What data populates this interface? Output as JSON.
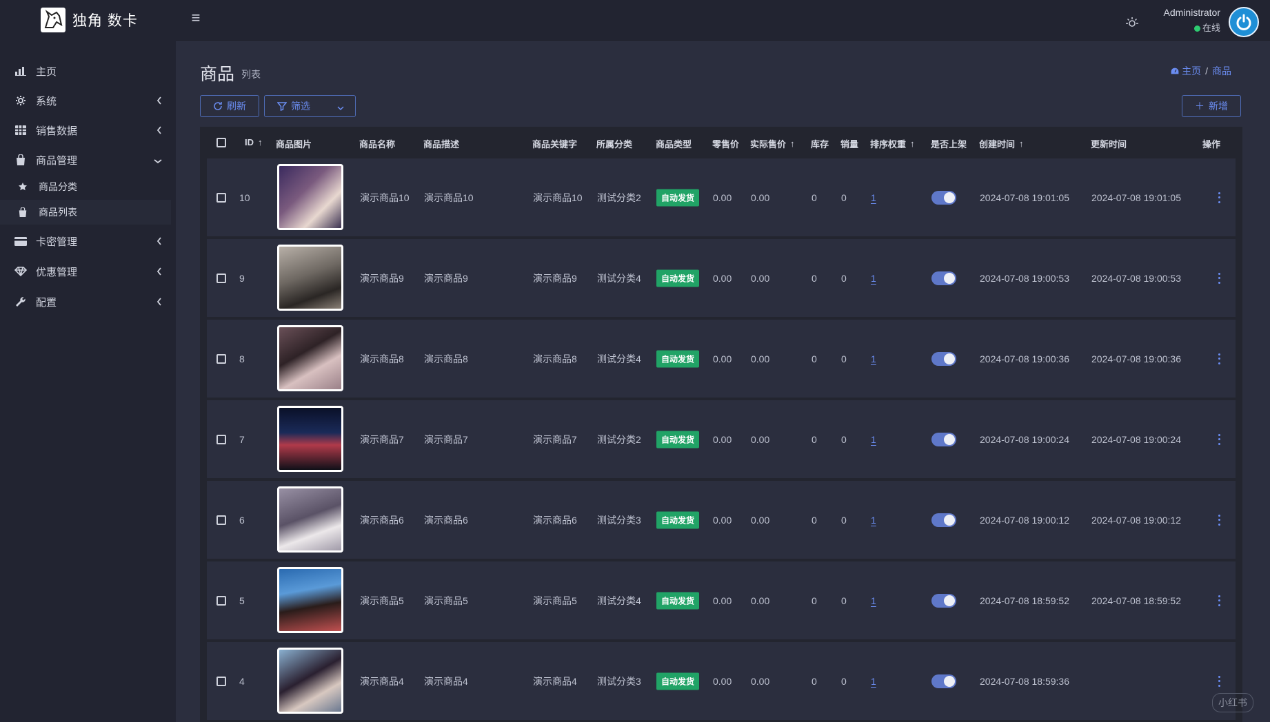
{
  "app": {
    "brand": "独角 数卡"
  },
  "user": {
    "name": "Administrator",
    "status": "在线"
  },
  "sidebar": {
    "items": [
      {
        "label": "主页",
        "icon": "bar-chart-icon"
      },
      {
        "label": "系统",
        "icon": "gear-icon"
      },
      {
        "label": "销售数据",
        "icon": "table-icon"
      },
      {
        "label": "商品管理",
        "icon": "shopping-bag-icon"
      },
      {
        "label": "卡密管理",
        "icon": "credit-card-icon"
      },
      {
        "label": "优惠管理",
        "icon": "diamond-icon"
      },
      {
        "label": "配置",
        "icon": "wrench-icon"
      }
    ],
    "sub_items": [
      {
        "label": "商品分类",
        "icon": "star-icon"
      },
      {
        "label": "商品列表",
        "icon": "shopping-bag-icon"
      }
    ]
  },
  "page": {
    "title": "商品",
    "subtitle": "列表"
  },
  "breadcrumb": {
    "home": "主页",
    "sep": "/",
    "current": "商品"
  },
  "toolbar": {
    "refresh": "刷新",
    "filter": "筛选",
    "add": "新增"
  },
  "table": {
    "headers": {
      "id": "ID",
      "image": "商品图片",
      "name": "商品名称",
      "desc": "商品描述",
      "keyword": "商品关键字",
      "category": "所属分类",
      "type": "商品类型",
      "retail": "零售价",
      "actual": "实际售价",
      "stock": "库存",
      "sales": "销量",
      "weight": "排序权重",
      "listed": "是否上架",
      "created": "创建时间",
      "updated": "更新时间",
      "ops": "操作"
    },
    "rows": [
      {
        "id": "10",
        "name": "演示商品10",
        "desc": "演示商品10",
        "keyword": "演示商品10",
        "category": "测试分类2",
        "type": "自动发货",
        "retail": "0.00",
        "actual": "0.00",
        "stock": "0",
        "sales": "0",
        "weight": "1",
        "created": "2024-07-08 19:01:05",
        "updated": "2024-07-08 19:01:05"
      },
      {
        "id": "9",
        "name": "演示商品9",
        "desc": "演示商品9",
        "keyword": "演示商品9",
        "category": "测试分类4",
        "type": "自动发货",
        "retail": "0.00",
        "actual": "0.00",
        "stock": "0",
        "sales": "0",
        "weight": "1",
        "created": "2024-07-08 19:00:53",
        "updated": "2024-07-08 19:00:53"
      },
      {
        "id": "8",
        "name": "演示商品8",
        "desc": "演示商品8",
        "keyword": "演示商品8",
        "category": "测试分类4",
        "type": "自动发货",
        "retail": "0.00",
        "actual": "0.00",
        "stock": "0",
        "sales": "0",
        "weight": "1",
        "created": "2024-07-08 19:00:36",
        "updated": "2024-07-08 19:00:36"
      },
      {
        "id": "7",
        "name": "演示商品7",
        "desc": "演示商品7",
        "keyword": "演示商品7",
        "category": "测试分类2",
        "type": "自动发货",
        "retail": "0.00",
        "actual": "0.00",
        "stock": "0",
        "sales": "0",
        "weight": "1",
        "created": "2024-07-08 19:00:24",
        "updated": "2024-07-08 19:00:24"
      },
      {
        "id": "6",
        "name": "演示商品6",
        "desc": "演示商品6",
        "keyword": "演示商品6",
        "category": "测试分类3",
        "type": "自动发货",
        "retail": "0.00",
        "actual": "0.00",
        "stock": "0",
        "sales": "0",
        "weight": "1",
        "created": "2024-07-08 19:00:12",
        "updated": "2024-07-08 19:00:12"
      },
      {
        "id": "5",
        "name": "演示商品5",
        "desc": "演示商品5",
        "keyword": "演示商品5",
        "category": "测试分类4",
        "type": "自动发货",
        "retail": "0.00",
        "actual": "0.00",
        "stock": "0",
        "sales": "0",
        "weight": "1",
        "created": "2024-07-08 18:59:52",
        "updated": "2024-07-08 18:59:52"
      },
      {
        "id": "4",
        "name": "演示商品4",
        "desc": "演示商品4",
        "keyword": "演示商品4",
        "category": "测试分类3",
        "type": "自动发货",
        "retail": "0.00",
        "actual": "0.00",
        "stock": "0",
        "sales": "0",
        "weight": "1",
        "created": "2024-07-08 18:59:36",
        "updated": ""
      }
    ]
  },
  "watermark": "小红书",
  "colors": {
    "accent": "#6b8df2",
    "badge": "#21a366",
    "bg": "#2b2e3e",
    "panel": "#222431"
  }
}
